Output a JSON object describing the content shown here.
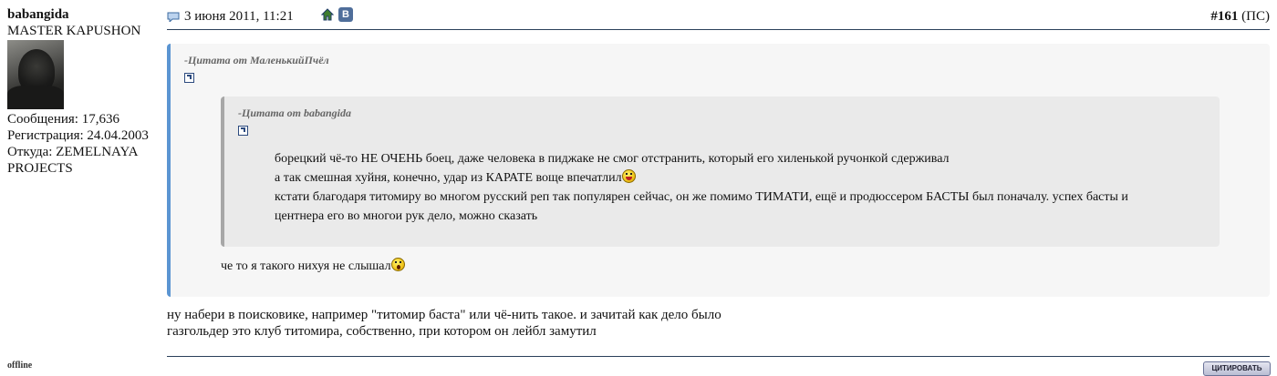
{
  "user": {
    "name": "babangida",
    "title": "MASTER KAPUSHON",
    "posts": "Сообщения: 17,636",
    "registration": "Регистрация: 24.04.2003",
    "location_line1": "Откуда: ZEMELNAYA",
    "location_line2": "PROJECTS",
    "status": "offline"
  },
  "post": {
    "date": "3 июня 2011, 11:21",
    "number": "#161",
    "number_suffix": "(ПС)",
    "vk_label": "В",
    "outer_quote": {
      "title": "-Цитата от МаленькийПчёл",
      "text": "че то я такого нихуя не слышал"
    },
    "inner_quote": {
      "title": "-Цитата от babangida",
      "lines": [
        "борецкий чё-то НЕ ОЧЕНЬ боец, даже человека в пиджаке не смог отстранить, который его хиленькой ручонкой сдерживал",
        "а так смешная хуйня, конечно, удар из КАРАТЕ воще впечатлил",
        "кстати благодаря титомиру во многом русский реп так популярен сейчас, он же помимо ТИМАТИ, ещё и продюссером БАСТЫ был поначалу. успех басты и",
        "центнера его во многои рук дело, можно сказать"
      ]
    },
    "body_lines": [
      "ну набери в поисковике, например \"титомир баста\" или чё-нить такое. и зачитай как дело было",
      "газгольдер это клуб титомира, собственно, при котором он лейбл замутил"
    ],
    "quote_button": "ЦИТИРОВАТЬ"
  },
  "colors": {
    "outer_quote_border": "#5b95d2",
    "inner_quote_border": "#a7a7a7",
    "header_rule": "#2a3f5a"
  },
  "icons": [
    "message-icon",
    "home-icon",
    "vk-icon",
    "quote-link-icon",
    "smiley-tongue-icon",
    "smiley-shocked-icon"
  ]
}
